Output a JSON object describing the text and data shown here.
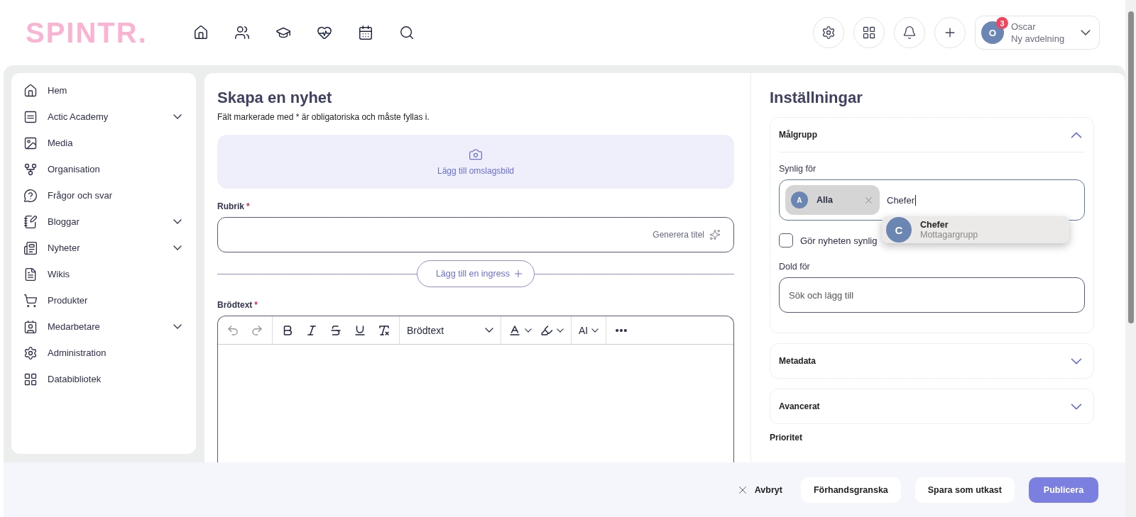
{
  "header": {
    "logo": "SPINTR.",
    "user": {
      "name": "Oscar",
      "department": "Ny avdelning",
      "avatar": "O",
      "badge": "3"
    }
  },
  "sidebar": {
    "items": [
      {
        "label": "Hem",
        "expandable": false
      },
      {
        "label": "Actic Academy",
        "expandable": true
      },
      {
        "label": "Media",
        "expandable": false
      },
      {
        "label": "Organisation",
        "expandable": false
      },
      {
        "label": "Frågor och svar",
        "expandable": false
      },
      {
        "label": "Bloggar",
        "expandable": true
      },
      {
        "label": "Nyheter",
        "expandable": true
      },
      {
        "label": "Wikis",
        "expandable": false
      },
      {
        "label": "Produkter",
        "expandable": false
      },
      {
        "label": "Medarbetare",
        "expandable": true
      },
      {
        "label": "Administration",
        "expandable": false
      },
      {
        "label": "Databibliotek",
        "expandable": false
      }
    ]
  },
  "editor": {
    "title": "Skapa en nyhet",
    "note": "Fält markerade med * är obligatoriska och måste fyllas i.",
    "cover_label": "Lägg till omslagsbild",
    "headline": {
      "label": "Rubrik",
      "marker": "*",
      "action": "Generera titel"
    },
    "ingress_button": "Lägg till en ingress",
    "body": {
      "label": "Brödtext",
      "marker": "*",
      "format": "Brödtext",
      "ai": "AI"
    }
  },
  "settings": {
    "title": "Inställningar",
    "sections": [
      {
        "title": "Målgrupp",
        "expanded": true
      },
      {
        "title": "Metadata",
        "expanded": false
      },
      {
        "title": "Avancerat",
        "expanded": false
      }
    ],
    "audience": {
      "visible_label": "Synlig för",
      "chips": [
        {
          "letter": "A",
          "label": "Alla"
        }
      ],
      "query": "Chefer",
      "suggestions": [
        {
          "letter": "C",
          "name": "Chefer",
          "subtitle": "Mottagargrupp"
        }
      ],
      "checkbox": {
        "label": "Gör nyheten synlig",
        "checked": false
      },
      "hidden_label": "Dold för",
      "hidden_placeholder": "Sök och lägg till"
    },
    "priority_label": "Prioritet"
  },
  "footer": {
    "buttons": [
      {
        "label": "Avbryt",
        "kind": "cancel"
      },
      {
        "label": "Förhandsgranska",
        "kind": "secondary"
      },
      {
        "label": "Spara som utkast",
        "kind": "secondary"
      },
      {
        "label": "Publicera",
        "kind": "primary"
      }
    ]
  }
}
